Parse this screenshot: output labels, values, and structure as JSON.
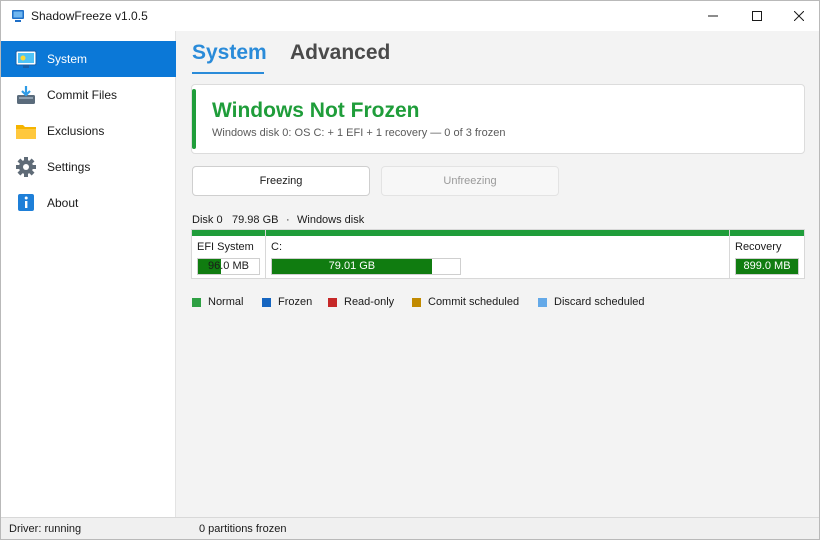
{
  "window": {
    "title": "ShadowFreeze v1.0.5"
  },
  "sidebar": {
    "items": [
      {
        "label": "System",
        "icon": "system-monitor-icon",
        "active": true
      },
      {
        "label": "Commit Files",
        "icon": "commit-tray-icon",
        "active": false
      },
      {
        "label": "Exclusions",
        "icon": "folder-icon",
        "active": false
      },
      {
        "label": "Settings",
        "icon": "gear-icon",
        "active": false
      },
      {
        "label": "About",
        "icon": "info-icon",
        "active": false
      }
    ]
  },
  "tabs": [
    {
      "label": "System",
      "active": true
    },
    {
      "label": "Advanced",
      "active": false
    }
  ],
  "status": {
    "title": "Windows Not Frozen",
    "subtitle": "Windows disk 0:  OS C: + 1 EFI + 1 recovery   —   0 of 3 frozen",
    "color": "#1f9d3a"
  },
  "buttons": {
    "freeze": "Freezing",
    "unfreeze": "Unfreezing"
  },
  "disk": {
    "name": "Disk 0",
    "size": "79.98 GB",
    "separator": "·",
    "description": "Windows disk",
    "partitions": [
      {
        "name": "EFI System",
        "size": "96.0 MB",
        "used_fraction": 0.38
      },
      {
        "name": "C:",
        "size": "79.01 GB",
        "used_fraction": 0.85
      },
      {
        "name": "Recovery",
        "size": "899.0 MB",
        "used_fraction": 1.0
      }
    ]
  },
  "legend": [
    {
      "label": "Normal",
      "color": "#2ea043"
    },
    {
      "label": "Frozen",
      "color": "#1565c0"
    },
    {
      "label": "Read-only",
      "color": "#c62828"
    },
    {
      "label": "Commit scheduled",
      "color": "#c18a00"
    },
    {
      "label": "Discard scheduled",
      "color": "#64a9e8"
    }
  ],
  "statusbar": {
    "driver": "Driver: running",
    "partitions": "0 partitions frozen"
  },
  "colors": {
    "accent": "#0b78d7",
    "tab_active": "#2a8bd9",
    "normal_green": "#1f9d3a",
    "fill_green": "#107c10"
  }
}
